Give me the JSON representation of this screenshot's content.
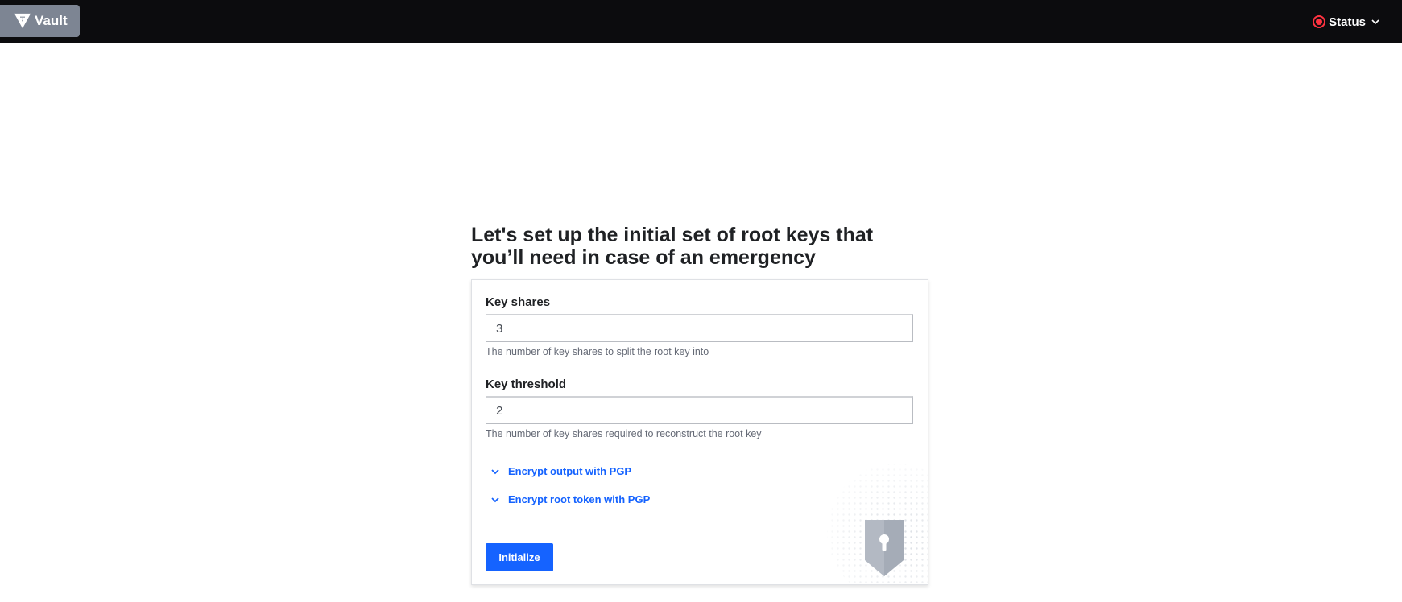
{
  "navbar": {
    "logo_label": "Vault",
    "status_label": "Status",
    "status_color": "#ff3340"
  },
  "main": {
    "title": "Let's set up the initial set of root keys that you’ll need in case of an emergency",
    "key_shares": {
      "label": "Key shares",
      "value": "3",
      "help": "The number of key shares to split the root key into"
    },
    "key_threshold": {
      "label": "Key threshold",
      "value": "2",
      "help": "The number of key shares required to reconstruct the root key"
    },
    "toggles": [
      {
        "label": "Encrypt output with PGP",
        "icon": "chevron-down-icon"
      },
      {
        "label": "Encrypt root token with PGP",
        "icon": "chevron-down-icon"
      }
    ],
    "submit_label": "Initialize",
    "accent_color": "#1563ff"
  }
}
